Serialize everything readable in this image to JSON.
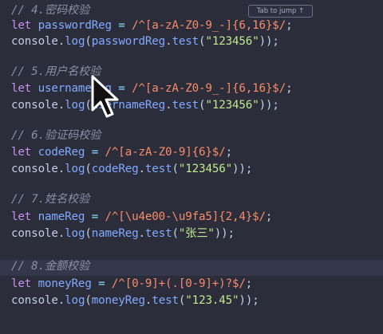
{
  "tooltip": {
    "text": "Tab to jump ↑"
  },
  "lines": [
    {
      "name": "comment-password",
      "tokens": [
        {
          "t": "comment",
          "v": "// 4.密码校验"
        }
      ]
    },
    {
      "name": "code-password-reg",
      "tokens": [
        {
          "t": "kw",
          "v": "let "
        },
        {
          "t": "var",
          "v": "passwordReg"
        },
        {
          "t": "op",
          "v": " = "
        },
        {
          "t": "regex",
          "v": "/^[a-zA-Z0-9_-]{6,16}$/"
        },
        {
          "t": "punc",
          "v": ";"
        }
      ]
    },
    {
      "name": "code-password-test",
      "tokens": [
        {
          "t": "obj",
          "v": "console"
        },
        {
          "t": "punc",
          "v": "."
        },
        {
          "t": "fn",
          "v": "log"
        },
        {
          "t": "punc",
          "v": "("
        },
        {
          "t": "var",
          "v": "passwordReg"
        },
        {
          "t": "punc",
          "v": "."
        },
        {
          "t": "fn",
          "v": "test"
        },
        {
          "t": "punc",
          "v": "("
        },
        {
          "t": "str",
          "v": "\"123456\""
        },
        {
          "t": "punc",
          "v": "));"
        }
      ]
    },
    {
      "name": "comment-username",
      "tokens": [
        {
          "t": "comment",
          "v": "// 5.用户名校验"
        }
      ]
    },
    {
      "name": "code-username-reg",
      "tokens": [
        {
          "t": "kw",
          "v": "let "
        },
        {
          "t": "var",
          "v": "usernameReg"
        },
        {
          "t": "op",
          "v": " = "
        },
        {
          "t": "regex",
          "v": "/^[a-zA-Z0-9_-]{6,16}$/"
        },
        {
          "t": "punc",
          "v": ";"
        }
      ]
    },
    {
      "name": "code-username-test",
      "tokens": [
        {
          "t": "obj",
          "v": "console"
        },
        {
          "t": "punc",
          "v": "."
        },
        {
          "t": "fn",
          "v": "log"
        },
        {
          "t": "punc",
          "v": "("
        },
        {
          "t": "var",
          "v": "usernameReg"
        },
        {
          "t": "punc",
          "v": "."
        },
        {
          "t": "fn",
          "v": "test"
        },
        {
          "t": "punc",
          "v": "("
        },
        {
          "t": "str",
          "v": "\"123456\""
        },
        {
          "t": "punc",
          "v": "));"
        }
      ]
    },
    {
      "name": "comment-code",
      "tokens": [
        {
          "t": "comment",
          "v": "// 6.验证码校验"
        }
      ]
    },
    {
      "name": "code-code-reg",
      "tokens": [
        {
          "t": "kw",
          "v": "let "
        },
        {
          "t": "var",
          "v": "codeReg"
        },
        {
          "t": "op",
          "v": " = "
        },
        {
          "t": "regex",
          "v": "/^[a-zA-Z0-9]{6}$/"
        },
        {
          "t": "punc",
          "v": ";"
        }
      ]
    },
    {
      "name": "code-code-test",
      "tokens": [
        {
          "t": "obj",
          "v": "console"
        },
        {
          "t": "punc",
          "v": "."
        },
        {
          "t": "fn",
          "v": "log"
        },
        {
          "t": "punc",
          "v": "("
        },
        {
          "t": "var",
          "v": "codeReg"
        },
        {
          "t": "punc",
          "v": "."
        },
        {
          "t": "fn",
          "v": "test"
        },
        {
          "t": "punc",
          "v": "("
        },
        {
          "t": "str",
          "v": "\"123456\""
        },
        {
          "t": "punc",
          "v": "));"
        }
      ]
    },
    {
      "name": "comment-name",
      "tokens": [
        {
          "t": "comment",
          "v": "// 7.姓名校验"
        }
      ]
    },
    {
      "name": "code-name-reg",
      "tokens": [
        {
          "t": "kw",
          "v": "let "
        },
        {
          "t": "var",
          "v": "nameReg"
        },
        {
          "t": "op",
          "v": " = "
        },
        {
          "t": "regex",
          "v": "/^[\\u4e00-\\u9fa5]{2,4}$/"
        },
        {
          "t": "punc",
          "v": ";"
        }
      ]
    },
    {
      "name": "code-name-test",
      "tokens": [
        {
          "t": "obj",
          "v": "console"
        },
        {
          "t": "punc",
          "v": "."
        },
        {
          "t": "fn",
          "v": "log"
        },
        {
          "t": "punc",
          "v": "("
        },
        {
          "t": "var",
          "v": "nameReg"
        },
        {
          "t": "punc",
          "v": "."
        },
        {
          "t": "fn",
          "v": "test"
        },
        {
          "t": "punc",
          "v": "("
        },
        {
          "t": "str",
          "v": "\"张三\""
        },
        {
          "t": "punc",
          "v": "));"
        }
      ]
    },
    {
      "name": "comment-money",
      "tokens": [
        {
          "t": "comment",
          "v": "// 8.金额校验"
        }
      ]
    },
    {
      "name": "code-money-reg",
      "tokens": [
        {
          "t": "kw",
          "v": "let "
        },
        {
          "t": "var",
          "v": "moneyReg"
        },
        {
          "t": "op",
          "v": " = "
        },
        {
          "t": "regex",
          "v": "/^[0-9]+(.[0-9]+)?$/"
        },
        {
          "t": "punc",
          "v": ";"
        }
      ]
    },
    {
      "name": "code-money-test",
      "tokens": [
        {
          "t": "obj",
          "v": "console"
        },
        {
          "t": "punc",
          "v": "."
        },
        {
          "t": "fn",
          "v": "log"
        },
        {
          "t": "punc",
          "v": "("
        },
        {
          "t": "var",
          "v": "moneyReg"
        },
        {
          "t": "punc",
          "v": "."
        },
        {
          "t": "fn",
          "v": "test"
        },
        {
          "t": "punc",
          "v": "("
        },
        {
          "t": "str",
          "v": "\"123.45\""
        },
        {
          "t": "punc",
          "v": "));"
        }
      ]
    }
  ],
  "colors": {
    "background": "#2b2d3a",
    "comment": "#8a8fa6",
    "keyword": "#c792ea",
    "variable": "#82aaff",
    "regex": "#f78c6c",
    "string": "#c3e88d"
  },
  "icons": {
    "cursor": "mouse-pointer-icon"
  }
}
